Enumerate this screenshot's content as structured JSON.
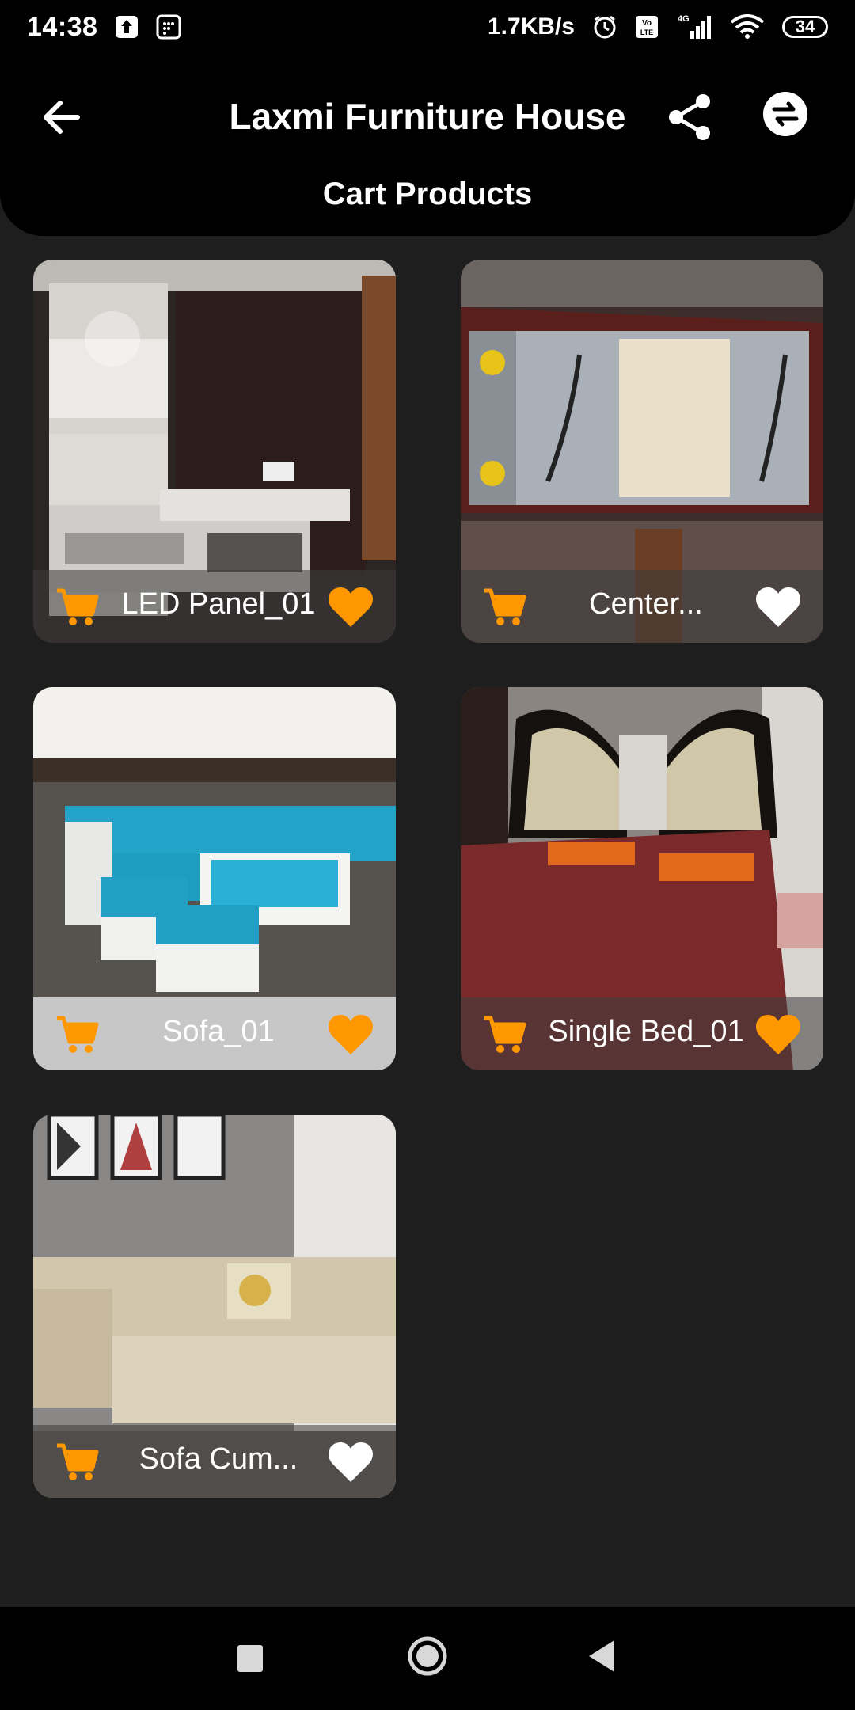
{
  "status_bar": {
    "time": "14:38",
    "speed": "1.7KB/s",
    "battery": "34",
    "network": "4G",
    "icons": [
      "upload-icon",
      "calendar-icon",
      "alarm-icon",
      "volte-icon",
      "signal-icon",
      "wifi-icon"
    ]
  },
  "app_bar": {
    "title": "Laxmi Furniture House",
    "subtitle": "Cart Products",
    "icons": [
      "back-arrow-icon",
      "share-icon",
      "swap-icon"
    ]
  },
  "products": [
    {
      "name": "LED Panel_01",
      "favorite": true,
      "image": "led-panel-image"
    },
    {
      "name": "Center...",
      "favorite": false,
      "image": "center-table-image"
    },
    {
      "name": "Sofa_01",
      "favorite": true,
      "image": "sofa-image"
    },
    {
      "name": "Single Bed_01",
      "favorite": true,
      "image": "single-bed-image"
    },
    {
      "name": "Sofa Cum...",
      "favorite": false,
      "image": "sofa-cum-bed-image"
    }
  ],
  "colors": {
    "accent": "#ff9800",
    "background": "#1e1e1e",
    "app_bar": "#000000"
  },
  "nav_bar": {
    "icons": [
      "recents-icon",
      "home-icon",
      "back-triangle-icon"
    ]
  }
}
